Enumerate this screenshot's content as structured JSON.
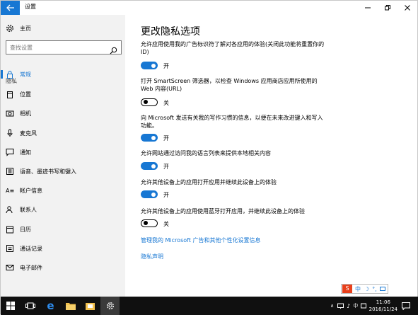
{
  "window": {
    "title": "设置"
  },
  "sidebar": {
    "home_label": "主页",
    "search_placeholder": "查找设置",
    "section_label": "隐私",
    "items": [
      {
        "label": "常规",
        "icon": "lock-icon",
        "active": true
      },
      {
        "label": "位置",
        "icon": "location-icon"
      },
      {
        "label": "相机",
        "icon": "camera-icon"
      },
      {
        "label": "麦克风",
        "icon": "microphone-icon"
      },
      {
        "label": "通知",
        "icon": "notification-icon"
      },
      {
        "label": "语音、墨迹书写和键入",
        "icon": "speech-icon"
      },
      {
        "label": "帐户信息",
        "icon": "account-info-icon"
      },
      {
        "label": "联系人",
        "icon": "contacts-icon"
      },
      {
        "label": "日历",
        "icon": "calendar-icon"
      },
      {
        "label": "通话记录",
        "icon": "call-history-icon"
      },
      {
        "label": "电子邮件",
        "icon": "email-icon"
      }
    ]
  },
  "main": {
    "title": "更改隐私选项",
    "options": [
      {
        "desc": "允许应用使用我的广告标识符了解对各应用的体验(关闭此功能将重置你的 ID)",
        "state": "开",
        "on": true
      },
      {
        "desc": "打开 SmartScreen 筛选器，以检查 Windows 应用商店应用所使用的 Web 内容(URL)",
        "state": "关",
        "on": false
      },
      {
        "desc": "向 Microsoft 发送有关我的写作习惯的信息，以便在未来改进键入和写入功能。",
        "state": "开",
        "on": true
      },
      {
        "desc": "允许网站通过访问我的语言列表来提供本地相关内容",
        "state": "开",
        "on": true
      },
      {
        "desc": "允许其他设备上的应用打开应用并继续此设备上的体验",
        "state": "开",
        "on": true
      },
      {
        "desc": "允许其他设备上的应用使用蓝牙打开应用，并继续此设备上的体验",
        "state": "关",
        "on": false
      }
    ],
    "link_ads": "管理我的 Microsoft 广告和其他个性化设置信息",
    "link_privacy": "隐私声明"
  },
  "taskbar": {
    "time": "11:06",
    "date": "2016/11/24",
    "ime_label": "中"
  },
  "colors": {
    "accent": "#1777d3",
    "sidebar_bg": "#f2f2f2",
    "taskbar_bg": "#101010"
  }
}
